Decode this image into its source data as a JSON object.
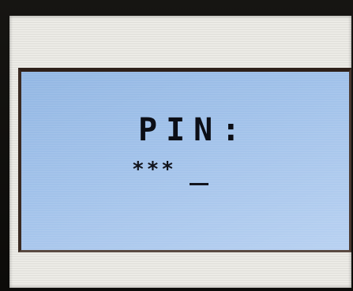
{
  "dialog": {
    "title": "PIN:",
    "entry_masked": "***",
    "cursor": "_"
  },
  "colors": {
    "screen_background": "#ecebe6",
    "dialog_background": "#a2c2ea",
    "dialog_border": "#2d1f18",
    "text": "#0c0e16"
  }
}
